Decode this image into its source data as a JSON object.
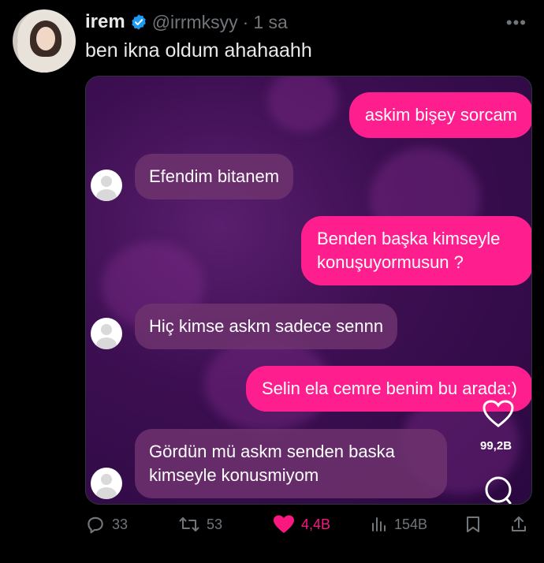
{
  "tweet": {
    "author_name": "irem",
    "handle": "@irrmksyy",
    "separator": "·",
    "time": "1 sa",
    "more_label": "•••",
    "text": "ben ikna oldum ahahaahh"
  },
  "chat": {
    "messages": [
      {
        "side": "out",
        "text": "askim bişey sorcam"
      },
      {
        "side": "in",
        "text": "Efendim bitanem"
      },
      {
        "side": "out",
        "text": "Benden başka kimseyle konuşuyormusun ?"
      },
      {
        "side": "in",
        "text": "Hiç kimse askm sadece sennn"
      },
      {
        "side": "out",
        "text": "Selin ela cemre benim bu arada:)"
      },
      {
        "side": "in",
        "text": "Gördün mü askm senden baska kimseyle konusmiyom"
      }
    ],
    "overlay_like_count": "99,2B"
  },
  "actions": {
    "reply_count": "33",
    "retweet_count": "53",
    "like_count": "4,4B",
    "view_count": "154B"
  },
  "colors": {
    "accent_pink": "#ff1e8e",
    "liked": "#f91880",
    "verified": "#1d9bf0",
    "muted": "#71767b"
  }
}
